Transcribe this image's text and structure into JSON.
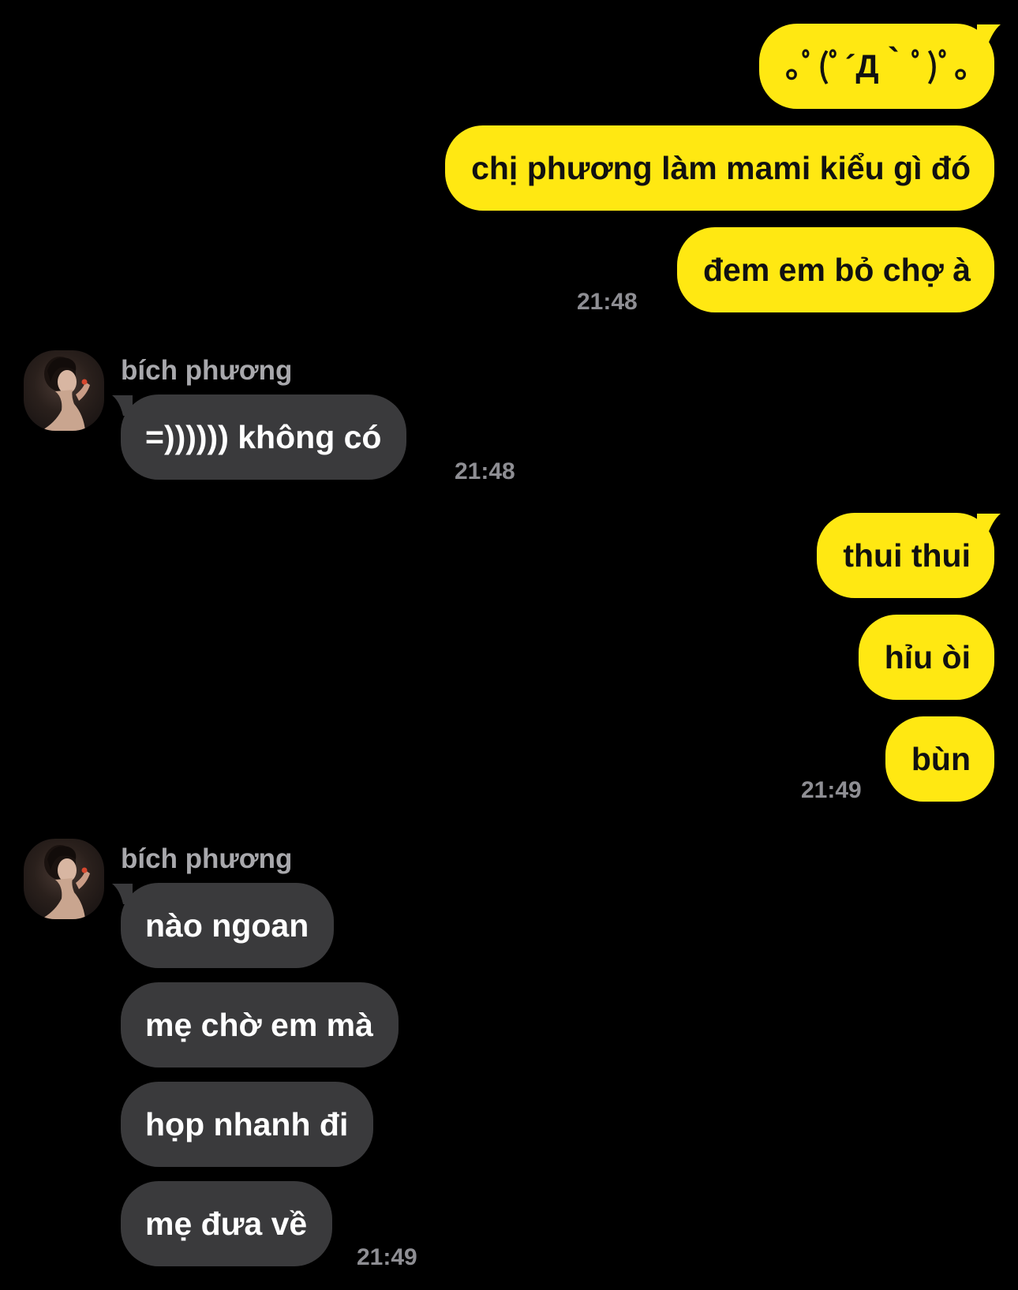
{
  "colors": {
    "background": "#000000",
    "outgoing_bubble": "#FFE812",
    "outgoing_text": "#111111",
    "incoming_bubble": "#3A3A3C",
    "incoming_text": "#FFFFFF",
    "timestamp": "#8E8E93",
    "sender_name": "#A8A8AC"
  },
  "groups": [
    {
      "direction": "outgoing",
      "messages": [
        "｡ﾟ(ﾟ´Д｀ﾟ)ﾟ｡",
        "chị phương làm mami kiểu gì đó",
        "đem em bỏ chợ à"
      ],
      "time": "21:48"
    },
    {
      "direction": "incoming",
      "sender": "bích phương",
      "avatar_icon": "contact-avatar-photo",
      "messages": [
        "=)))))) không có"
      ],
      "time": "21:48"
    },
    {
      "direction": "outgoing",
      "messages": [
        "thui thui",
        "hỉu òi",
        "bùn"
      ],
      "time": "21:49"
    },
    {
      "direction": "incoming",
      "sender": "bích phương",
      "avatar_icon": "contact-avatar-photo",
      "messages": [
        "nào ngoan",
        "mẹ chờ em mà",
        "họp nhanh đi",
        "mẹ đưa về"
      ],
      "time": "21:49"
    }
  ]
}
